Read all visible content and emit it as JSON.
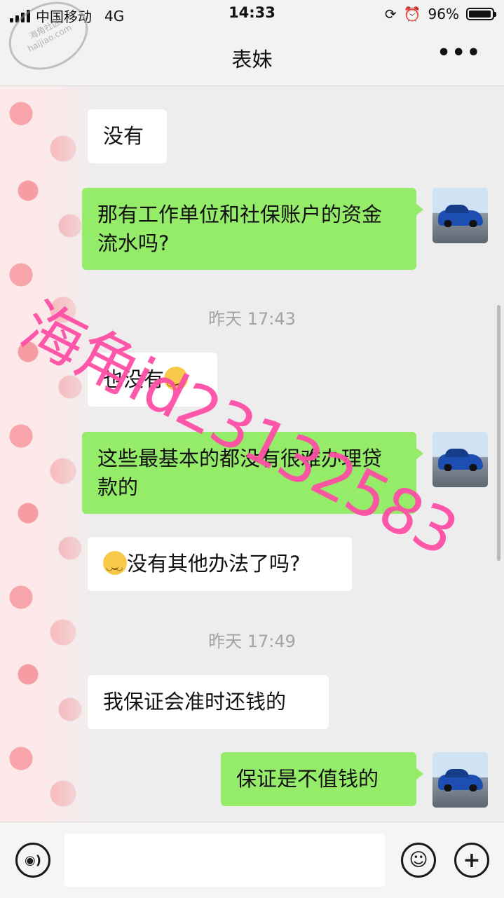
{
  "status_bar": {
    "carrier": "中国移动",
    "network": "4G",
    "time": "14:33",
    "battery_text": "96%",
    "battery_level": 0.96
  },
  "nav": {
    "title": "表妹",
    "more_icon": "more-dots-icon"
  },
  "messages": [
    {
      "side": "in",
      "text": "没有"
    },
    {
      "side": "out",
      "text": "那有工作单位和社保账户的资金流水吗?"
    },
    {
      "side": "time",
      "text": "昨天 17:43"
    },
    {
      "side": "in",
      "text": "也没有",
      "emoji_after": "smile-emoji"
    },
    {
      "side": "out",
      "text": "这些最基本的都没有很难办理贷款的"
    },
    {
      "side": "in",
      "text": "没有其他办法了吗?",
      "emoji_before": "smile-emoji"
    },
    {
      "side": "time",
      "text": "昨天 17:49"
    },
    {
      "side": "in",
      "text": "我保证会准时还钱的"
    },
    {
      "side": "out",
      "text": "保证是不值钱的"
    }
  ],
  "watermark": {
    "text": "海角id23132583",
    "stamp_text": "海角社区 haijiao.com",
    "color": "#ff4fa6"
  },
  "input_bar": {
    "voice_icon": "voice-icon",
    "emoji_icon": "emoji-icon",
    "plus_icon": "plus-icon"
  },
  "colors": {
    "outgoing_bubble": "#95ec69",
    "incoming_bubble": "#ffffff",
    "background": "#ededed"
  }
}
